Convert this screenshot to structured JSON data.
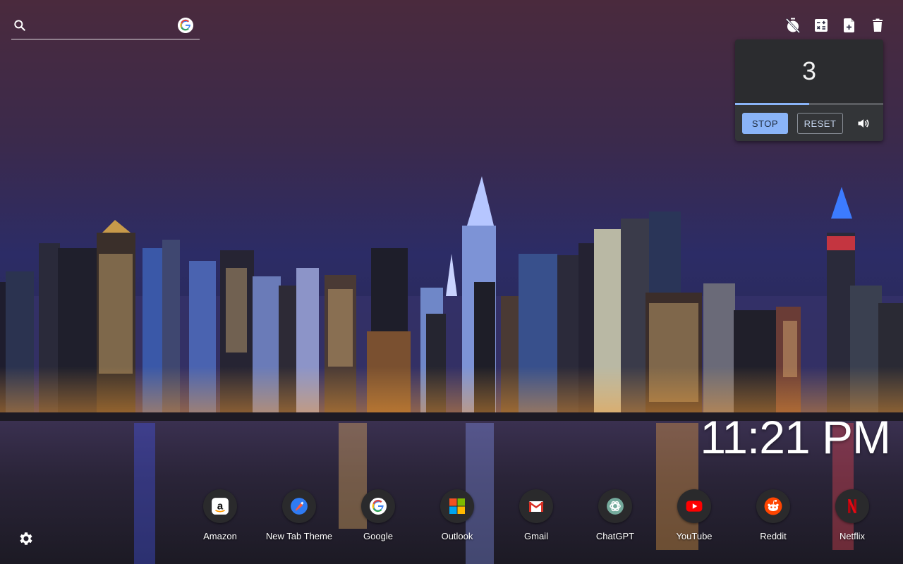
{
  "search": {
    "placeholder": "",
    "value": "",
    "engine_icon": "google-icon"
  },
  "toolbar": {
    "items": [
      {
        "name": "timer-off-icon"
      },
      {
        "name": "calculator-icon"
      },
      {
        "name": "new-note-icon"
      },
      {
        "name": "trash-icon"
      }
    ]
  },
  "timer": {
    "value": "3",
    "progress_fraction": 0.5,
    "stop_label": "STOP",
    "reset_label": "RESET",
    "volume_icon": "volume-icon",
    "accent_color": "#8ab4f8"
  },
  "clock": {
    "time": "11:21 PM"
  },
  "shortcuts": [
    {
      "label": "Amazon",
      "icon": "amazon-icon"
    },
    {
      "label": "New Tab Theme",
      "icon": "new-tab-theme-icon"
    },
    {
      "label": "Google",
      "icon": "google-icon"
    },
    {
      "label": "Outlook",
      "icon": "outlook-icon"
    },
    {
      "label": "Gmail",
      "icon": "gmail-icon"
    },
    {
      "label": "ChatGPT",
      "icon": "chatgpt-icon"
    },
    {
      "label": "YouTube",
      "icon": "youtube-icon"
    },
    {
      "label": "Reddit",
      "icon": "reddit-icon"
    },
    {
      "label": "Netflix",
      "icon": "netflix-icon"
    }
  ],
  "settings": {
    "icon": "gear-icon"
  }
}
